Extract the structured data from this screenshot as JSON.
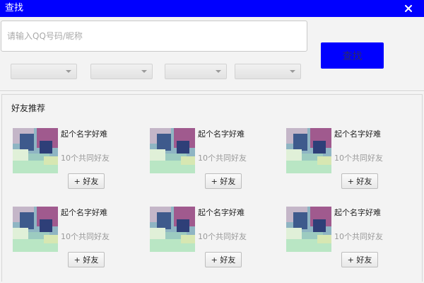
{
  "window": {
    "title": "查找",
    "close_icon": "close-icon"
  },
  "search": {
    "placeholder": "请输入QQ号码/昵称",
    "value": "",
    "button_label": "查找"
  },
  "filters": [
    {
      "value": ""
    },
    {
      "value": ""
    },
    {
      "value": ""
    },
    {
      "value": ""
    }
  ],
  "recommend": {
    "title": "好友推荐",
    "friends": [
      {
        "name": "起个名字好难",
        "mutual": "10个共同好友",
        "add_label": "+ 好友"
      },
      {
        "name": "起个名字好难",
        "mutual": "10个共同好友",
        "add_label": "+ 好友"
      },
      {
        "name": "起个名字好难",
        "mutual": "10个共同好友",
        "add_label": "+ 好友"
      },
      {
        "name": "起个名字好难",
        "mutual": "10个共同好友",
        "add_label": "+ 好友"
      },
      {
        "name": "起个名字好难",
        "mutual": "10个共同好友",
        "add_label": "+ 好友"
      },
      {
        "name": "起个名字好难",
        "mutual": "10个共同好友",
        "add_label": "+ 好友"
      }
    ]
  },
  "colors": {
    "titlebar": "#0000ff",
    "search_button": "#0000ff"
  }
}
